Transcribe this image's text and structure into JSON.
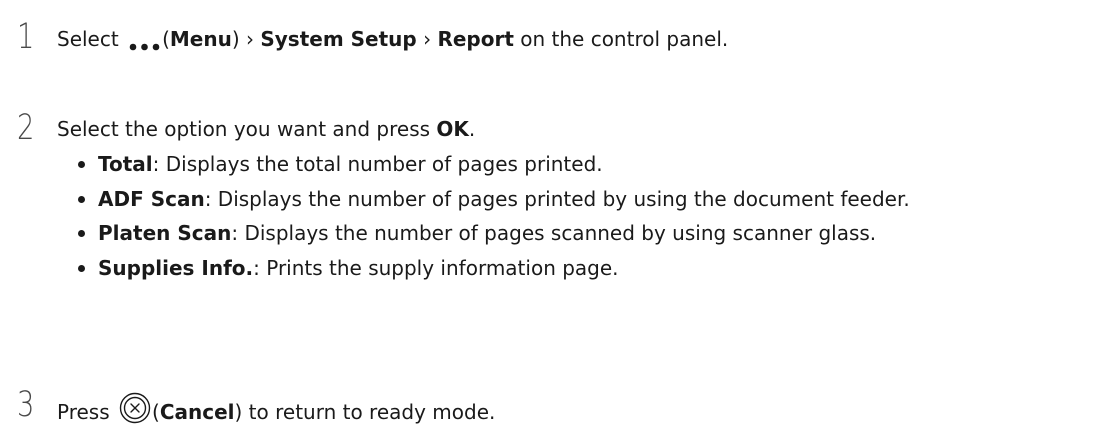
{
  "steps": [
    {
      "number": "1",
      "prefix": "Select ",
      "menu_icon": "more-dots-icon",
      "paren_open": "(",
      "menu_label": "Menu",
      "paren_close": ")",
      "sep1": " › ",
      "system_setup": "System Setup",
      "sep2": " › ",
      "report": "Report",
      "suffix": " on the control panel."
    },
    {
      "number": "2",
      "prefix": "Select the option you want and press ",
      "ok": "OK",
      "suffix": ".",
      "options": [
        {
          "name": "Total",
          "desc": ": Displays the total number of pages printed."
        },
        {
          "name": "ADF Scan",
          "desc": ": Displays the number of pages printed by using the document feeder."
        },
        {
          "name": "Platen Scan",
          "desc": ": Displays the number of pages scanned by using scanner glass."
        },
        {
          "name": "Supplies Info.",
          "desc": ": Prints the supply information page."
        }
      ]
    },
    {
      "number": "3",
      "prefix": "Press ",
      "cancel_icon": "cancel-circle-icon",
      "paren_open": "(",
      "cancel_label": "Cancel",
      "paren_close": ")",
      "suffix": " to return to ready mode."
    }
  ]
}
